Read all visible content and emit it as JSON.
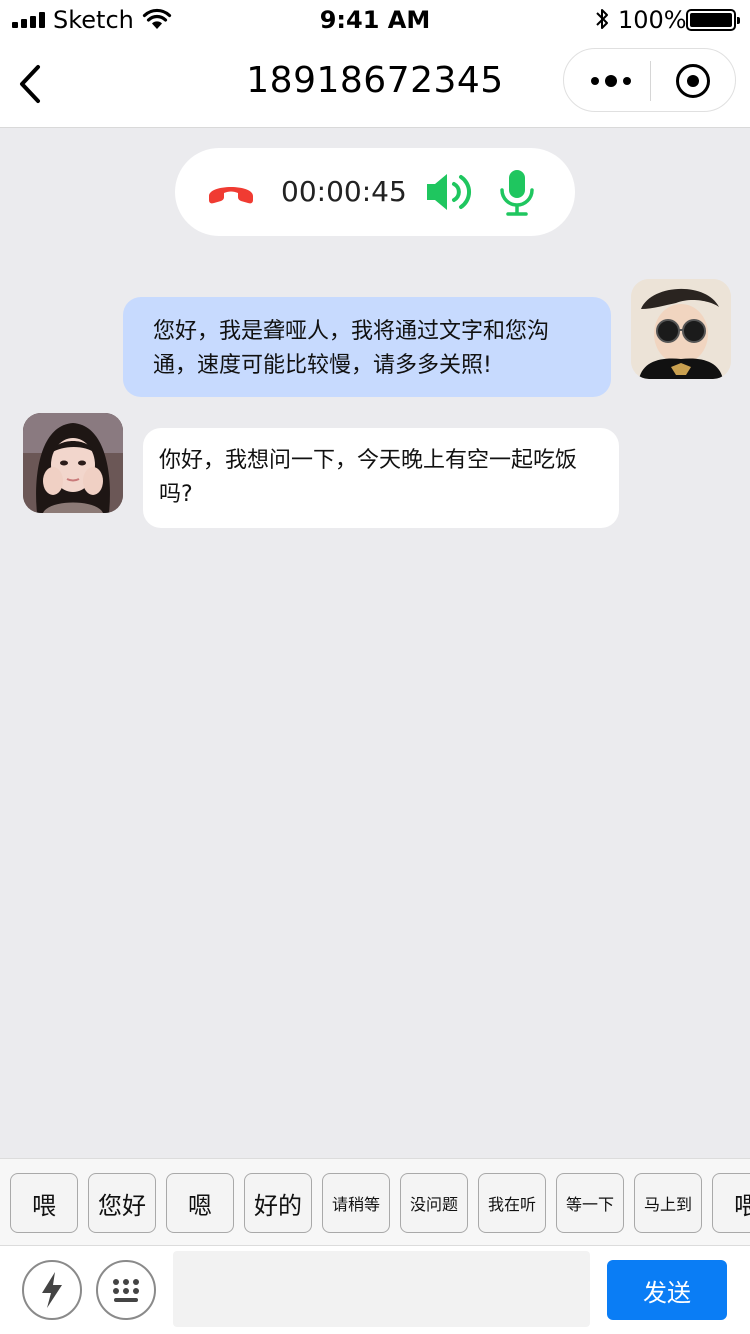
{
  "status_bar": {
    "carrier": "Sketch",
    "time": "9:41 AM",
    "battery": "100%"
  },
  "nav": {
    "title": "18918672345"
  },
  "call": {
    "timer": "00:00:45",
    "colors": {
      "hangup": "#f03b32",
      "active": "#1fc65f"
    }
  },
  "messages": [
    {
      "from": "me",
      "text": "您好，我是聋哑人，我将通过文字和您沟通，速度可能比较慢，请多多关照!"
    },
    {
      "from": "other",
      "text": "你好，我想问一下，今天晚上有空一起吃饭吗?"
    }
  ],
  "quick_replies": [
    "喂",
    "您好",
    "嗯",
    "好的",
    "请稍等",
    "没问题",
    "我在听",
    "等一下",
    "马上到",
    "喂"
  ],
  "input": {
    "value": "",
    "send_label": "发送"
  },
  "colors": {
    "background": "#ebebee",
    "my_bubble": "#c7dafe",
    "send_button": "#0a7df5"
  }
}
